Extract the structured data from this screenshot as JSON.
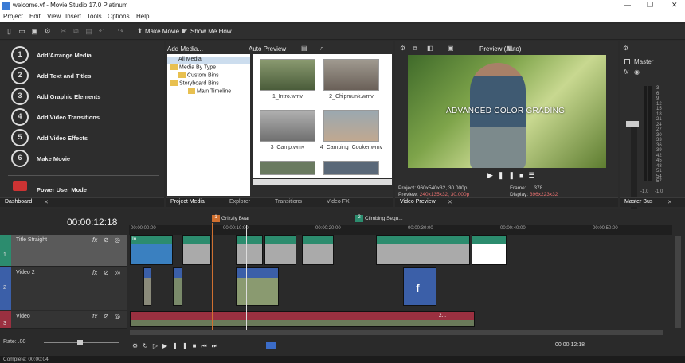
{
  "window": {
    "title": "welcome.vf - Movie Studio 17.0 Platinum",
    "controls": [
      "minimize-icon",
      "maximize-icon",
      "close-icon"
    ]
  },
  "menu": [
    "Project",
    "Edit",
    "View",
    "Insert",
    "Tools",
    "Options",
    "Help"
  ],
  "toolbar": {
    "make_movie": "Make Movie",
    "show_me_how": "Show Me How"
  },
  "guide": {
    "items": [
      {
        "num": "1",
        "label": "Add/Arrange Media"
      },
      {
        "num": "2",
        "label": "Add Text and Titles"
      },
      {
        "num": "3",
        "label": "Add Graphic Elements"
      },
      {
        "num": "4",
        "label": "Add Video Transitions"
      },
      {
        "num": "5",
        "label": "Add Video Effects"
      },
      {
        "num": "6",
        "label": "Make Movie"
      }
    ],
    "power_mode": "Power User Mode",
    "tab": "Dashboard"
  },
  "media": {
    "add_media": "Add Media...",
    "auto_preview": "Auto Preview",
    "tree": [
      "All Media",
      "Media By Type",
      "Custom Bins",
      "Storyboard Bins",
      "Main Timeline"
    ],
    "thumbs": [
      "1_Intro.wmv",
      "2_Chipmunk.wmv",
      "3_Camp.wmv",
      "4_Camping_Cooker.wmv"
    ],
    "tabs": [
      "Project Media",
      "Explorer",
      "Transitions",
      "Video FX"
    ]
  },
  "preview": {
    "mode": "Preview (Auto)",
    "caption": "ADVANCED COLOR GRADING",
    "project_label": "Project:",
    "project_value": "960x540x32, 30.000p",
    "preview_label": "Preview:",
    "preview_value": "240x135x32, 30.000p",
    "frame_label": "Frame:",
    "frame_value": "378",
    "display_label": "Display:",
    "display_value": "396x223x32",
    "tab": "Video Preview"
  },
  "master": {
    "label": "Master",
    "scale": [
      "3",
      "6",
      "9",
      "12",
      "15",
      "18",
      "21",
      "24",
      "27",
      "30",
      "33",
      "36",
      "39",
      "42",
      "45",
      "48",
      "51",
      "54",
      "57"
    ],
    "bottom": [
      "-1.0",
      "-1.0"
    ],
    "tab": "Master Bus"
  },
  "timeline": {
    "timecode": "00:00:12:18",
    "markers": [
      {
        "num": "1",
        "label": "Grizzly Bear"
      },
      {
        "num": "2",
        "label": "Climbing Sequ..."
      }
    ],
    "ruler": [
      "00:00:00:00",
      "00:00:10:00",
      "00:00:20:00",
      "00:00:30:00",
      "00:00:40:00",
      "00:00:50:00"
    ],
    "tracks": [
      {
        "num": "1",
        "name": "Title Straight"
      },
      {
        "num": "2",
        "name": "Video 2"
      },
      {
        "num": "3",
        "name": "Video"
      }
    ],
    "clip_labels": [
      "In...",
      "2..."
    ],
    "rate": "Rate: .00",
    "end_timecode": "00:00:12:18"
  },
  "status": "Complete: 00:00:04",
  "colors": {
    "title_track": "#2c8c6e",
    "video_track": "#3b5fa8",
    "audio_track": "#9a3040",
    "accent": "#e8c050"
  }
}
